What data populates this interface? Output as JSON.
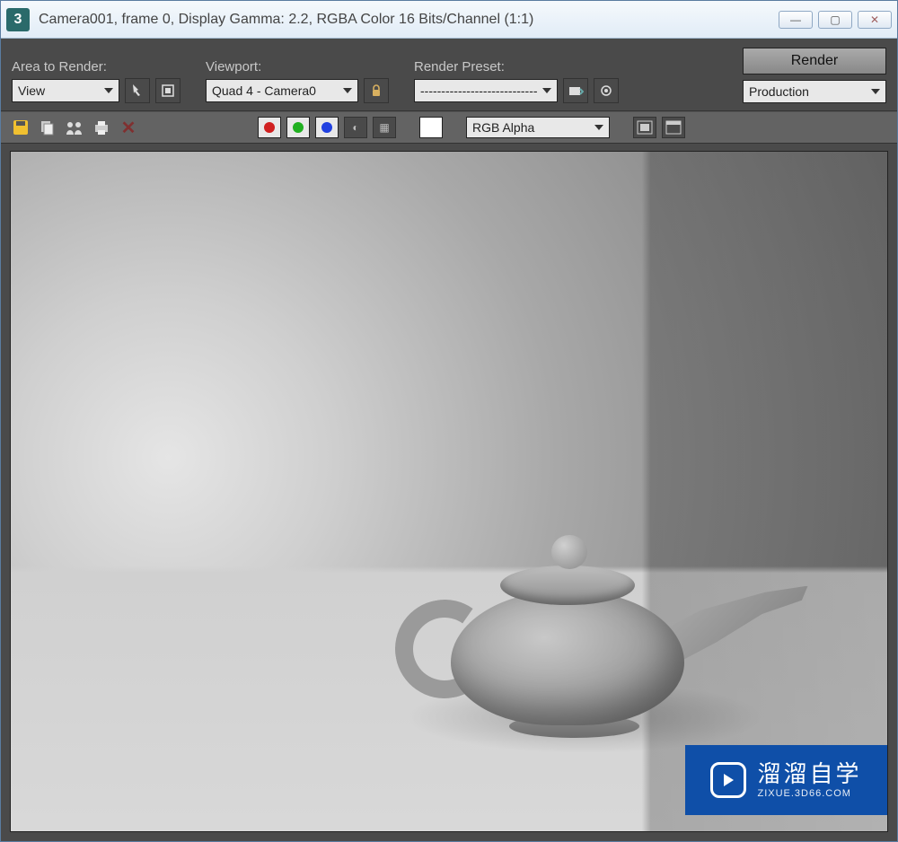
{
  "window": {
    "title": "Camera001, frame 0, Display Gamma: 2.2, RGBA Color 16 Bits/Channel (1:1)"
  },
  "toolbar": {
    "area_label": "Area to Render:",
    "area_value": "View",
    "viewport_label": "Viewport:",
    "viewport_value": "Quad 4 - Camera0",
    "preset_label": "Render Preset:",
    "preset_value": "----------------------------",
    "render_label": "Render",
    "production_value": "Production"
  },
  "channelbar": {
    "channel_value": "RGB Alpha"
  },
  "watermark": {
    "cn": "溜溜自学",
    "en": "ZIXUE.3D66.COM"
  }
}
